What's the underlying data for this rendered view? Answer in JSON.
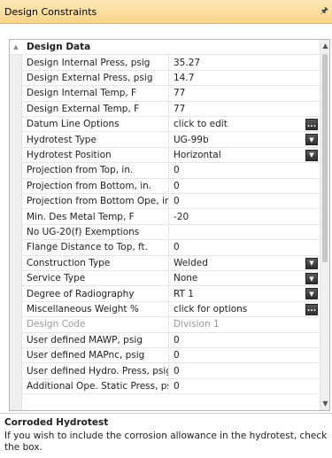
{
  "panel": {
    "title": "Design Constraints",
    "pin_icon": "pin-icon"
  },
  "category": {
    "label": "Design Data",
    "expander": "▲"
  },
  "properties": [
    {
      "name": "Design Internal Press, psig",
      "value": "35.27",
      "editor": "none"
    },
    {
      "name": "Design External Press, psig",
      "value": "14.7",
      "editor": "none"
    },
    {
      "name": "Design Internal Temp, F",
      "value": "77",
      "editor": "none"
    },
    {
      "name": "Design External Temp, F",
      "value": "77",
      "editor": "none"
    },
    {
      "name": "Datum Line Options",
      "value": "click to edit",
      "editor": "ellipsis"
    },
    {
      "name": "Hydrotest Type",
      "value": "UG-99b",
      "editor": "dropdown"
    },
    {
      "name": "Hydrotest Position",
      "value": "Horizontal",
      "editor": "dropdown"
    },
    {
      "name": "Projection from Top, in.",
      "value": "0",
      "editor": "none"
    },
    {
      "name": "Projection from Bottom, in.",
      "value": "0",
      "editor": "none"
    },
    {
      "name": "Projection from Bottom Ope, in.",
      "value": "0",
      "editor": "none"
    },
    {
      "name": "Min. Des Metal Temp, F",
      "value": "-20",
      "editor": "none"
    },
    {
      "name": "No UG-20(f) Exemptions",
      "value": "",
      "editor": "none"
    },
    {
      "name": "Flange Distance to Top, ft.",
      "value": "0",
      "editor": "none"
    },
    {
      "name": "Construction Type",
      "value": "Welded",
      "editor": "dropdown"
    },
    {
      "name": "Service Type",
      "value": "None",
      "editor": "dropdown"
    },
    {
      "name": "Degree of Radiography",
      "value": "RT 1",
      "editor": "dropdown"
    },
    {
      "name": "Miscellaneous Weight %",
      "value": "click for options",
      "editor": "ellipsis"
    },
    {
      "name": "Design Code",
      "value": "Division 1",
      "editor": "none",
      "disabled": true
    },
    {
      "name": "User defined MAWP, psig",
      "value": "0",
      "editor": "none"
    },
    {
      "name": "User defined MAPnc, psig",
      "value": "0",
      "editor": "none"
    },
    {
      "name": "User defined Hydro. Press, psig",
      "value": "0",
      "editor": "none"
    },
    {
      "name": "Additional Ope. Static Press, psig",
      "value": "0",
      "editor": "none"
    }
  ],
  "help": {
    "title": "Corroded Hydrotest",
    "description": "If you wish to include the corrosion allowance in the hydrotest, check the box."
  }
}
